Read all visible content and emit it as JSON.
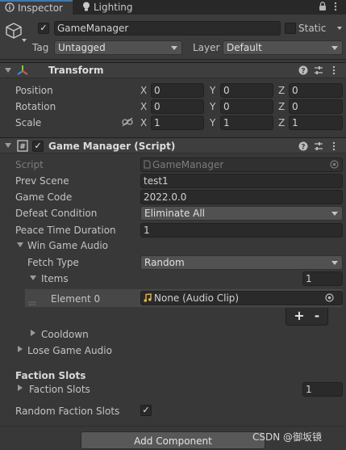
{
  "tabs": {
    "inspector": "Inspector",
    "lighting": "Lighting"
  },
  "object": {
    "name": "GameManager",
    "static_label": "Static",
    "tag_label": "Tag",
    "tag_value": "Untagged",
    "layer_label": "Layer",
    "layer_value": "Default"
  },
  "transform": {
    "title": "Transform",
    "position_label": "Position",
    "rotation_label": "Rotation",
    "scale_label": "Scale",
    "axis_x": "X",
    "axis_y": "Y",
    "axis_z": "Z",
    "position": {
      "x": "0",
      "y": "0",
      "z": "0"
    },
    "rotation": {
      "x": "0",
      "y": "0",
      "z": "0"
    },
    "scale": {
      "x": "1",
      "y": "1",
      "z": "1"
    }
  },
  "script": {
    "title": "Game Manager (Script)",
    "script_label": "Script",
    "script_value": "GameManager",
    "prev_scene_label": "Prev Scene",
    "prev_scene_value": "test1",
    "game_code_label": "Game Code",
    "game_code_value": "2022.0.0",
    "defeat_condition_label": "Defeat Condition",
    "defeat_condition_value": "Eliminate All",
    "peace_time_label": "Peace Time Duration",
    "peace_time_value": "1",
    "win_audio_label": "Win Game Audio",
    "fetch_type_label": "Fetch Type",
    "fetch_type_value": "Random",
    "items_label": "Items",
    "items_count": "1",
    "element0_label": "Element 0",
    "element0_value": "None (Audio Clip)",
    "plus_label": "+",
    "minus_label": "-",
    "cooldown_label": "Cooldown",
    "lose_audio_label": "Lose Game Audio",
    "faction_slots_header": "Faction Slots",
    "faction_slots_label": "Faction Slots",
    "faction_slots_count": "1",
    "random_faction_label": "Random Faction Slots",
    "random_faction_checked": "✓"
  },
  "footer": {
    "add_component": "Add Component",
    "watermark": "CSDN @御坂镜"
  },
  "colors": {
    "background": "#383838",
    "field": "#2a2a2a",
    "accent_tab": "#3a79bb",
    "audio_icon": "#e8b33c"
  },
  "icons": {
    "inspector_tab": "info-icon",
    "lighting_tab": "lightbulb-icon",
    "lock": "lock-icon",
    "menu": "kebab-menu-icon",
    "gameobject": "cube-icon",
    "transform": "transform-axes-icon",
    "script": "script-icon",
    "help": "help-icon",
    "presets": "sliders-icon",
    "more": "kebab-menu-icon",
    "constrain": "link-icon",
    "audio": "audio-clip-icon",
    "target": "object-picker-icon"
  }
}
